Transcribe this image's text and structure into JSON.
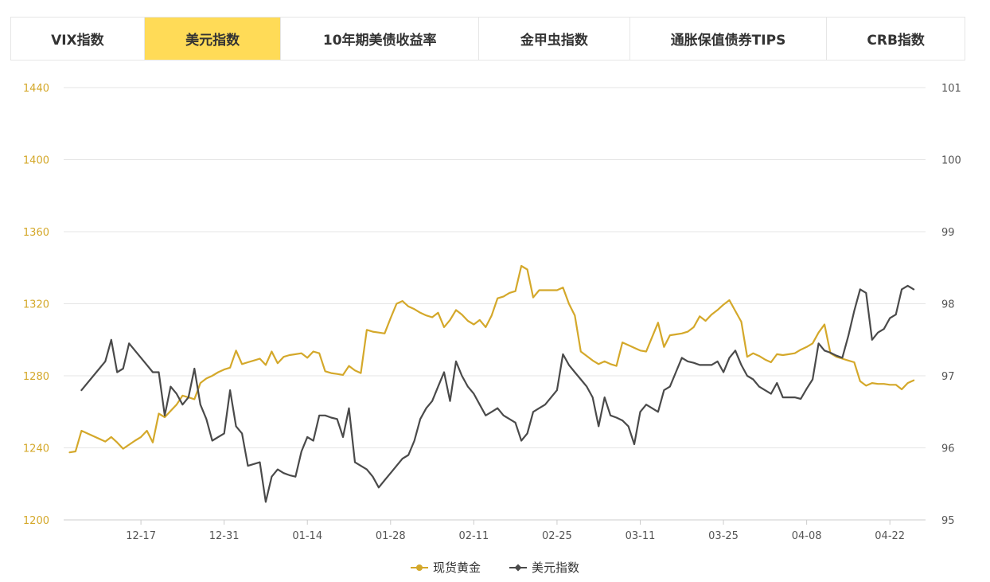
{
  "tabs": [
    {
      "label": "VIX指数",
      "active": false
    },
    {
      "label": "美元指数",
      "active": true
    },
    {
      "label": "10年期美债收益率",
      "active": false
    },
    {
      "label": "金甲虫指数",
      "active": false
    },
    {
      "label": "通胀保值债券TIPS",
      "active": false
    },
    {
      "label": "CRB指数",
      "active": false
    }
  ],
  "colors": {
    "gold": "#d4a82a",
    "usd": "#4a4a4a",
    "active_tab": "#ffdb57",
    "left_axis_text": "#d4a82a",
    "right_axis_text": "#555555",
    "grid": "#e5e5e5"
  },
  "chart_data": {
    "type": "line",
    "title": "",
    "x_ticks": [
      "12-17",
      "12-31",
      "01-14",
      "01-28",
      "02-11",
      "02-25",
      "03-11",
      "03-25",
      "04-08",
      "04-22"
    ],
    "x_tick_day_index": [
      13,
      27,
      41,
      55,
      69,
      83,
      97,
      111,
      125,
      139
    ],
    "x_day_range": [
      0,
      145
    ],
    "y_left": {
      "range": [
        1200,
        1440
      ],
      "ticks": [
        1200,
        1240,
        1280,
        1320,
        1360,
        1400,
        1440
      ]
    },
    "y_right": {
      "range": [
        95,
        101
      ],
      "ticks": [
        95,
        96,
        97,
        98,
        99,
        100,
        101
      ]
    },
    "grid": true,
    "legend_position": "bottom",
    "series": [
      {
        "name": "现货黄金",
        "axis": "left",
        "color": "#d4a82a",
        "marker": "circle",
        "x": [
          1,
          2,
          3,
          7,
          8,
          9,
          10,
          12,
          13,
          14,
          15,
          16,
          17,
          18,
          19,
          20,
          21,
          22,
          23,
          24,
          25,
          26,
          27,
          28,
          29,
          30,
          31,
          32,
          33,
          34,
          35,
          36,
          37,
          38,
          39,
          40,
          41,
          42,
          43,
          44,
          45,
          46,
          47,
          48,
          49,
          50,
          51,
          52,
          53,
          54,
          55,
          56,
          57,
          58,
          59,
          60,
          61,
          62,
          63,
          64,
          65,
          66,
          67,
          68,
          69,
          70,
          71,
          72,
          73,
          74,
          75,
          76,
          77,
          78,
          79,
          80,
          81,
          82,
          83,
          84,
          85,
          86,
          87,
          88,
          89,
          90,
          91,
          92,
          93,
          94,
          95,
          96,
          97,
          98,
          99,
          100,
          101,
          102,
          103,
          104,
          105,
          106,
          107,
          108,
          109,
          110,
          111,
          112,
          113,
          114,
          115,
          116,
          117,
          118,
          119,
          120,
          121,
          122,
          123,
          124,
          125,
          126,
          127,
          128,
          129,
          130,
          131,
          132,
          133,
          134,
          135,
          136,
          137,
          138,
          139,
          140,
          141,
          142,
          143
        ],
        "values": [
          1237.5,
          1238,
          1249.5,
          1243.5,
          1246,
          1243,
          1239.5,
          1244,
          1246,
          1249.5,
          1243,
          1259,
          1257,
          1260.5,
          1264,
          1269,
          1268,
          1267,
          1276,
          1278.5,
          1280,
          1282,
          1283.5,
          1284.5,
          1294,
          1286.5,
          1287.5,
          1288.5,
          1289.5,
          1286,
          1293.5,
          1287,
          1290.5,
          1291.5,
          1292,
          1292.5,
          1290,
          1293.5,
          1292.5,
          1282.5,
          1281.5,
          1281,
          1280.5,
          1285.5,
          1283,
          1281.5,
          1305.5,
          1304.5,
          1304,
          1303.5,
          1312,
          1320,
          1321.5,
          1318.5,
          1317,
          1315,
          1313.5,
          1312.5,
          1315,
          1307,
          1311,
          1316.5,
          1314,
          1310.5,
          1308.5,
          1311,
          1307,
          1313.5,
          1323,
          1324,
          1326,
          1327,
          1341,
          1339,
          1323.5,
          1327.5,
          1327.5,
          1327.5,
          1327.5,
          1329,
          1320,
          1313.5,
          1293.5,
          1291,
          1288.5,
          1286.5,
          1288,
          1286.5,
          1285.5,
          1298.5,
          1297,
          1295.5,
          1294,
          1293.5,
          1301.5,
          1309.5,
          1296,
          1302.5,
          1303,
          1303.5,
          1304.5,
          1307,
          1313,
          1310.5,
          1314,
          1316.5,
          1319.5,
          1322,
          1316,
          1310,
          1290.5,
          1292.5,
          1291,
          1289,
          1287.5,
          1292,
          1291.5,
          1292,
          1292.5,
          1294.5,
          1296,
          1298,
          1304,
          1308.5,
          1292.5,
          1290.5,
          1289.5,
          1288.5,
          1287.5,
          1277,
          1274.5,
          1276,
          1275.5,
          1275.5,
          1275,
          1275,
          1272.5,
          1276,
          1277.5
        ]
      },
      {
        "name": "美元指数",
        "axis": "right",
        "color": "#4a4a4a",
        "marker": "diamond",
        "x": [
          3,
          7,
          8,
          9,
          10,
          11,
          12,
          14,
          15,
          16,
          17,
          18,
          19,
          20,
          21,
          22,
          23,
          24,
          25,
          26,
          27,
          28,
          29,
          30,
          31,
          33,
          34,
          35,
          36,
          37,
          38,
          39,
          40,
          41,
          42,
          43,
          44,
          45,
          46,
          47,
          48,
          49,
          50,
          51,
          52,
          53,
          54,
          55,
          56,
          57,
          58,
          59,
          60,
          61,
          62,
          63,
          64,
          65,
          66,
          67,
          68,
          69,
          70,
          71,
          72,
          73,
          74,
          75,
          76,
          77,
          78,
          79,
          80,
          81,
          82,
          83,
          84,
          85,
          86,
          87,
          88,
          89,
          90,
          91,
          92,
          93,
          94,
          95,
          96,
          97,
          98,
          99,
          100,
          101,
          102,
          103,
          104,
          105,
          106,
          107,
          108,
          109,
          110,
          111,
          112,
          113,
          114,
          115,
          116,
          117,
          118,
          119,
          120,
          121,
          122,
          123,
          124,
          125,
          126,
          127,
          128,
          129,
          130,
          131,
          132,
          133,
          134,
          135,
          136,
          137,
          138,
          139,
          140,
          141,
          142,
          143
        ],
        "values": [
          96.8,
          97.2,
          97.5,
          97.05,
          97.1,
          97.45,
          97.35,
          97.15,
          97.05,
          97.05,
          96.45,
          96.85,
          96.75,
          96.6,
          96.7,
          97.1,
          96.6,
          96.4,
          96.1,
          96.15,
          96.2,
          96.8,
          96.3,
          96.2,
          95.75,
          95.8,
          95.25,
          95.6,
          95.7,
          95.65,
          95.62,
          95.6,
          95.95,
          96.15,
          96.1,
          96.45,
          96.45,
          96.42,
          96.4,
          96.15,
          96.55,
          95.8,
          95.75,
          95.7,
          95.6,
          95.45,
          95.55,
          95.65,
          95.75,
          95.85,
          95.9,
          96.1,
          96.4,
          96.55,
          96.65,
          96.85,
          97.05,
          96.65,
          97.2,
          97.0,
          96.85,
          96.75,
          96.6,
          96.45,
          96.5,
          96.55,
          96.45,
          96.4,
          96.35,
          96.1,
          96.2,
          96.5,
          96.55,
          96.6,
          96.7,
          96.8,
          97.3,
          97.15,
          97.05,
          96.95,
          96.85,
          96.7,
          96.3,
          96.7,
          96.45,
          96.42,
          96.38,
          96.3,
          96.05,
          96.5,
          96.6,
          96.55,
          96.5,
          96.8,
          96.85,
          97.05,
          97.25,
          97.2,
          97.18,
          97.15,
          97.15,
          97.15,
          97.2,
          97.05,
          97.25,
          97.35,
          97.15,
          97.0,
          96.95,
          96.85,
          96.8,
          96.75,
          96.9,
          96.7,
          96.7,
          96.7,
          96.68,
          96.82,
          96.95,
          97.45,
          97.35,
          97.32,
          97.28,
          97.25,
          97.55,
          97.9,
          98.2,
          98.15,
          97.5,
          97.6,
          97.65,
          97.8,
          97.85,
          98.2,
          98.25,
          98.2
        ]
      }
    ]
  }
}
